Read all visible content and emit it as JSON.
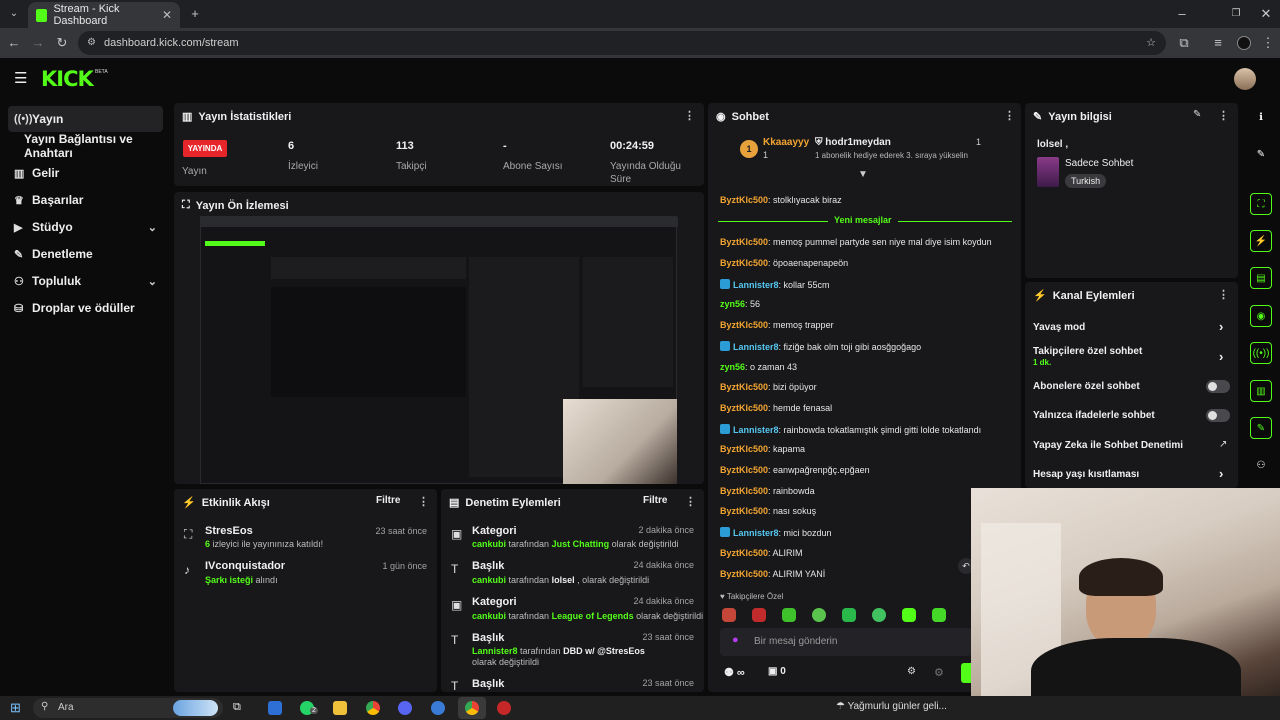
{
  "browser": {
    "tab_title": "Stream - Kick Dashboard",
    "url": "dashboard.kick.com/stream"
  },
  "header": {
    "logo": "KICK",
    "beta": "BETA"
  },
  "sidebar": {
    "items": [
      {
        "label": "Yayın"
      },
      {
        "label": "Yayın Bağlantısı ve Anahtarı"
      },
      {
        "label": "Gelir"
      },
      {
        "label": "Başarılar"
      },
      {
        "label": "Stüdyo"
      },
      {
        "label": "Denetleme"
      },
      {
        "label": "Topluluk"
      },
      {
        "label": "Droplar ve ödüller"
      }
    ]
  },
  "stats": {
    "title": "Yayın İstatistikleri",
    "live_badge": "YAYINDA",
    "live_label": "Yayın",
    "viewers_value": "6",
    "viewers_label": "İzleyici",
    "followers_value": "113",
    "followers_label": "Takipçi",
    "subs_value": "-",
    "subs_label": "Abone Sayısı",
    "duration_value": "00:24:59",
    "duration_label": "Yayında Olduğu Süre"
  },
  "preview": {
    "title": "Yayın Ön İzlemesi"
  },
  "activity": {
    "title": "Etkinlik Akışı",
    "filter": "Filtre",
    "items": [
      {
        "name": "StresEos",
        "count": "6",
        "text": "izleyici ile yayınınıza katıldı!",
        "time": "23 saat önce"
      },
      {
        "name": "IVconquistador",
        "highlight": "Şarkı isteği",
        "text": "alındı",
        "time": "1 gün önce"
      }
    ]
  },
  "moderation": {
    "title": "Denetim Eylemleri",
    "filter": "Filtre",
    "by": "tarafından",
    "changed": "olarak değiştirildi",
    "items": [
      {
        "type": "Kategori",
        "user": "cankubi",
        "value": "Just Chatting",
        "time": "2 dakika önce"
      },
      {
        "type": "Başlık",
        "user": "cankubi",
        "value": "lolsel",
        "time": "24 dakika önce"
      },
      {
        "type": "Kategori",
        "user": "cankubi",
        "value": "League of Legends",
        "time": "24 dakika önce"
      },
      {
        "type": "Başlık",
        "user": "Lannister8",
        "value": "DBD w/ @StresEos",
        "time": "23 saat önce"
      },
      {
        "type": "Başlık",
        "time": "23 saat önce"
      }
    ]
  },
  "chat": {
    "title": "Sohbet",
    "pinned_left_name": "Kkaaayyy",
    "pinned_left_count": "1",
    "pinned_left_rank": "1",
    "pinned_right_name": "hodr1meydan",
    "pinned_right_count": "1",
    "pinned_right_text": "1 abonelik hediye ederek 3. sıraya yükselin",
    "new_messages": "Yeni mesajlar",
    "messages": [
      {
        "user": "ByztKlc500",
        "text": "stolklıyacak biraz"
      },
      {
        "user": "ByztKlc500",
        "text": "memoş pummel partyde sen niye mal diye isim koydun"
      },
      {
        "user": "ByztKlc500",
        "text": "öpoaenapenapeön"
      },
      {
        "user": "Lannister8",
        "text": "kollar 55cm"
      },
      {
        "user": "zyn56",
        "text": "56"
      },
      {
        "user": "ByztKlc500",
        "text": "memoş trapper"
      },
      {
        "user": "Lannister8",
        "text": "fiziğe bak olm toji gibi aosğgoğago"
      },
      {
        "user": "zyn56",
        "text": "o zaman 43"
      },
      {
        "user": "ByztKlc500",
        "text": "bizi öpüyor"
      },
      {
        "user": "ByztKlc500",
        "text": "hemde fenasal"
      },
      {
        "user": "Lannister8",
        "text": "rainbowda tokatlamıştık şimdi gitti lolde tokatlandı"
      },
      {
        "user": "ByztKlc500",
        "text": "kapama"
      },
      {
        "user": "ByztKlc500",
        "text": "eanwpağrenpğç.epğaen"
      },
      {
        "user": "ByztKlc500",
        "text": "rainbowda"
      },
      {
        "user": "ByztKlc500",
        "text": "nası sokuş"
      },
      {
        "user": "Lannister8",
        "text": "mici bozdun"
      },
      {
        "user": "ByztKlc500",
        "text": "ALIRIM"
      },
      {
        "user": "ByztKlc500",
        "text": "ALIRIM YANİ"
      }
    ],
    "followers_only": "Takipçilere Özel",
    "placeholder": "Bir mesaj gönderin",
    "viewer_count": "∞",
    "box_count": "0"
  },
  "stream_info": {
    "title": "Yayın bilgisi",
    "stream_title": "lolsel ,",
    "category": "Sadece Sohbet",
    "tag": "Turkish"
  },
  "channel_actions": {
    "title": "Kanal Eylemleri",
    "slow_mode": "Yavaş mod",
    "followers_chat": "Takipçilere özel sohbet",
    "followers_chat_value": "1 dk.",
    "subs_chat": "Abonelere özel sohbet",
    "emotes_chat": "Yalnızca ifadelerle sohbet",
    "ai_mod": "Yapay Zeka ile Sohbet Denetimi",
    "age_restrict": "Hesap yaşı kısıtlaması"
  },
  "taskbar": {
    "search": "Ara",
    "weather": "Yağmurlu günler geli...",
    "badge": "2"
  },
  "colors": {
    "kick_green": "#53fc18",
    "live_red": "#e6262b",
    "panel": "#18181b",
    "orange_user": "#f3a531"
  }
}
